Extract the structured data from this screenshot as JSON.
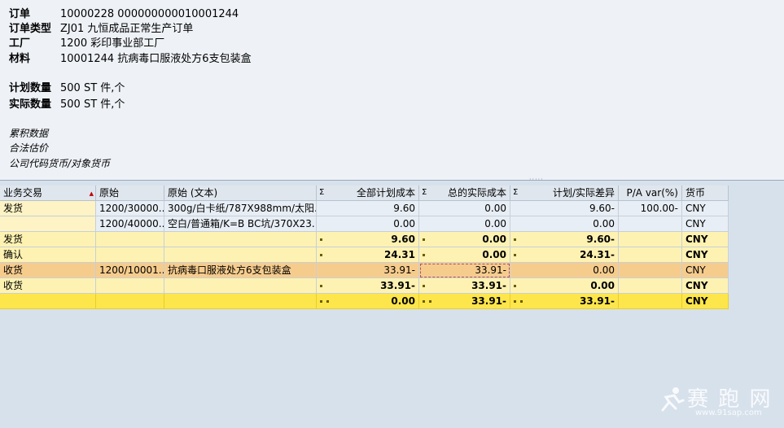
{
  "header": {
    "order_label": "订单",
    "order_value": "10000228 000000000010001244",
    "order_type_label": "订单类型",
    "order_type_value": "ZJ01 九恒成品正常生产订单",
    "plant_label": "工厂",
    "plant_value": "1200 彩印事业部工厂",
    "material_label": "材料",
    "material_value": "10001244 抗病毒口服液处方6支包装盒",
    "planned_qty_label": "计划数量",
    "planned_qty_value": "500 ST 件,个",
    "actual_qty_label": "实际数量",
    "actual_qty_value": "500 ST 件,个",
    "notes": [
      "累积数据",
      "合法估价",
      "公司代码货币/对象货币"
    ]
  },
  "table": {
    "columns": [
      "业务交易",
      "原始",
      "原始 (文本)",
      "全部计划成本",
      "总的实际成本",
      "计划/实际差异",
      "P/A var(%)",
      "货币"
    ],
    "sigma": "Σ",
    "rows": [
      {
        "type": "item",
        "cells": [
          "发货",
          "1200/30000...",
          "300g/白卡纸/787X988mm/太阳...",
          "9.60",
          "0.00",
          "9.60-",
          "100.00-",
          "CNY"
        ]
      },
      {
        "type": "item",
        "cells": [
          "",
          "1200/40000...",
          "空白/普通箱/K=B BC坑/370X23...",
          "0.00",
          "0.00",
          "0.00",
          "",
          "CNY"
        ]
      },
      {
        "type": "sub",
        "cells": [
          "发货",
          "",
          "",
          "9.60",
          "0.00",
          "9.60-",
          "",
          "CNY"
        ]
      },
      {
        "type": "sub",
        "cells": [
          "确认",
          "",
          "",
          "24.31",
          "0.00",
          "24.31-",
          "",
          "CNY"
        ]
      },
      {
        "type": "sel",
        "cells": [
          "收货",
          "1200/10001...",
          "抗病毒口服液处方6支包装盒",
          "33.91-",
          "33.91-",
          "0.00",
          "",
          "CNY"
        ]
      },
      {
        "type": "sub",
        "cells": [
          "收货",
          "",
          "",
          "33.91-",
          "33.91-",
          "0.00",
          "",
          "CNY"
        ]
      },
      {
        "type": "total",
        "cells": [
          "",
          "",
          "",
          "0.00",
          "33.91-",
          "33.91-",
          "",
          "CNY"
        ]
      }
    ]
  },
  "watermark": {
    "text": "赛 跑 网",
    "url": "www.91sap.com"
  },
  "colors": {
    "header_bg": "#eef2f7",
    "item_bg": "#fdf3c4",
    "subtotal_bg": "#fef2b2",
    "selected_bg": "#f6cc8d",
    "total_bg": "#fde64c"
  }
}
